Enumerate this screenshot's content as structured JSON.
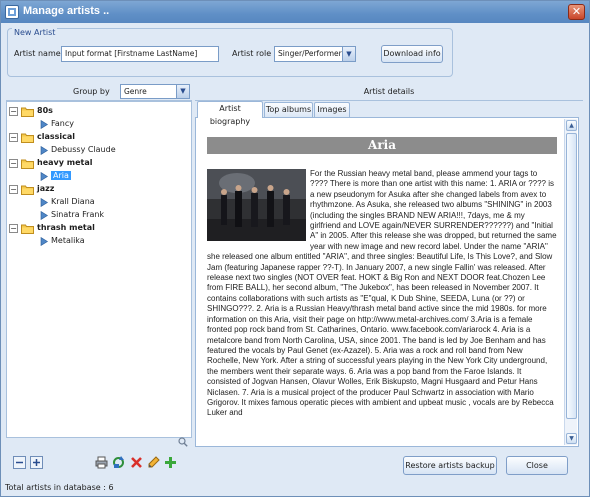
{
  "window": {
    "title": "Manage artists ..",
    "close_glyph": "✕"
  },
  "new_artist": {
    "legend": "New Artist",
    "name_label": "Artist name",
    "name_value": "Input format [Firstname  LastName]",
    "role_label": "Artist role",
    "role_value": "Singer/Performer",
    "download_label": "Download info"
  },
  "left_header": {
    "group_by_label": "Group by",
    "group_by_value": "Genre"
  },
  "right_header": {
    "title": "Artist  details"
  },
  "tree": [
    {
      "genre": "80s",
      "artists": [
        "Fancy"
      ]
    },
    {
      "genre": "classical",
      "artists": [
        "Debussy Claude"
      ]
    },
    {
      "genre": "heavy metal",
      "artists": [
        "Aria"
      ]
    },
    {
      "genre": "jazz",
      "artists": [
        "Krall Diana",
        "Sinatra Frank"
      ]
    },
    {
      "genre": "thrash metal",
      "artists": [
        "Metalika"
      ]
    }
  ],
  "tree_toggle_glyph": "−",
  "tabs": [
    "Artist biography",
    "Top albums",
    "Images"
  ],
  "biography": {
    "artist_name": "Aria",
    "text": "For the Russian heavy metal band, please ammend your tags to ???? There is more than one artist with this name: 1. ARIA or ???? is a new pseudonym for Asuka after she changed labels from avex to rhythmzone. As Asuka, she released two albums \"SHINING\" in 2003 (including the singles BRAND NEW ARIA!!!, 7days, me & my girlfriend and LOVE again/NEVER SURRENDER??????) and \"Initial A\" in 2005. After this release she was dropped, but returned the same year with new image and new record label. Under the name \"ARIA\" she released one album entitled \"ARIA\", and three singles: Beautiful Life, Is This Love?, and Slow Jam (featuring Japanese rapper ??-T). In January 2007, a new single Fallin' was released. After release next two singles (NOT OVER feat. HOKT & Big Ron and NEXT DOOR feat.Chozen Lee from FIRE BALL), her second album, \"The Jukebox\", has been released in November 2007. It contains collaborations with such artists as \"E\"qual, K Dub Shine, SEEDA, Luna (or ??) or SHINGO???. 2. Aria is a Russian Heavy/thrash metal band active since the mid 1980s. for more information on this Aria, visit their page on http://www.metal-archives.com/ 3.Aria is a female fronted pop rock band from St. Catharines, Ontario. www.facebook.com/ariarock 4. Aria is a metalcore band from North Carolina, USA, since 2001. The band is led by Joe Benham and has featured the vocals by Paul Genet (ex-Azazel). 5. Aria was a rock and roll band from New Rochelle, New York. After a string of successful years playing in the New York City underground, the members went their separate ways. 6. Aria was a pop band from the Faroe Islands. It consisted of Jogvan Hansen, Olavur Wolles, Erik Biskupsto, Magni Husgaard and Petur Hans Niclasen. 7. Aria is a musical project of the producer Paul Schwartz in association with Mario Grigorov. It mixes famous operatic pieces with ambient and upbeat music , vocals are by Rebecca Luker and"
  },
  "scroll": {
    "up_glyph": "▲",
    "down_glyph": "▼"
  },
  "toolbar_icons": [
    "collapse-all-icon",
    "expand-all-icon",
    "print-icon",
    "refresh-icon",
    "delete-icon",
    "edit-icon",
    "add-icon"
  ],
  "buttons": {
    "restore": "Restore artists backup",
    "close": "Close"
  },
  "status": {
    "text": "Total artists in database : 6"
  },
  "colors": {
    "selection": "#3399ff",
    "title_band": "#8c8c8c",
    "titlebar": "#5f8fc6"
  }
}
